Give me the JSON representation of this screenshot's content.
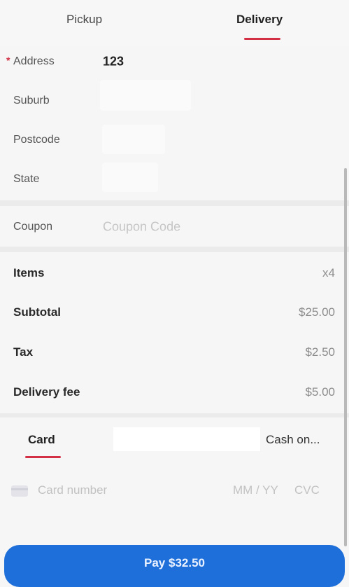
{
  "tabs": {
    "pickup": "Pickup",
    "delivery": "Delivery"
  },
  "address_form": {
    "required_marker": "*",
    "address_label": "Address",
    "address_value": "123",
    "suburb_label": "Suburb",
    "postcode_label": "Postcode",
    "state_label": "State"
  },
  "coupon": {
    "label": "Coupon",
    "placeholder": "Coupon Code"
  },
  "summary": {
    "items_label": "Items",
    "items_value": "x4",
    "subtotal_label": "Subtotal",
    "subtotal_value": "$25.00",
    "tax_label": "Tax",
    "tax_value": "$2.50",
    "delivery_label": "Delivery fee",
    "delivery_value": "$5.00"
  },
  "payment_tabs": {
    "card": "Card",
    "cash": "Cash on..."
  },
  "card_form": {
    "card_number_placeholder": "Card number",
    "expiry_placeholder": "MM / YY",
    "cvc_placeholder": "CVC"
  },
  "pay_button": {
    "label": "Pay $32.50"
  },
  "colors": {
    "accent": "#d32f45",
    "primary_button": "#1e6fd9"
  }
}
